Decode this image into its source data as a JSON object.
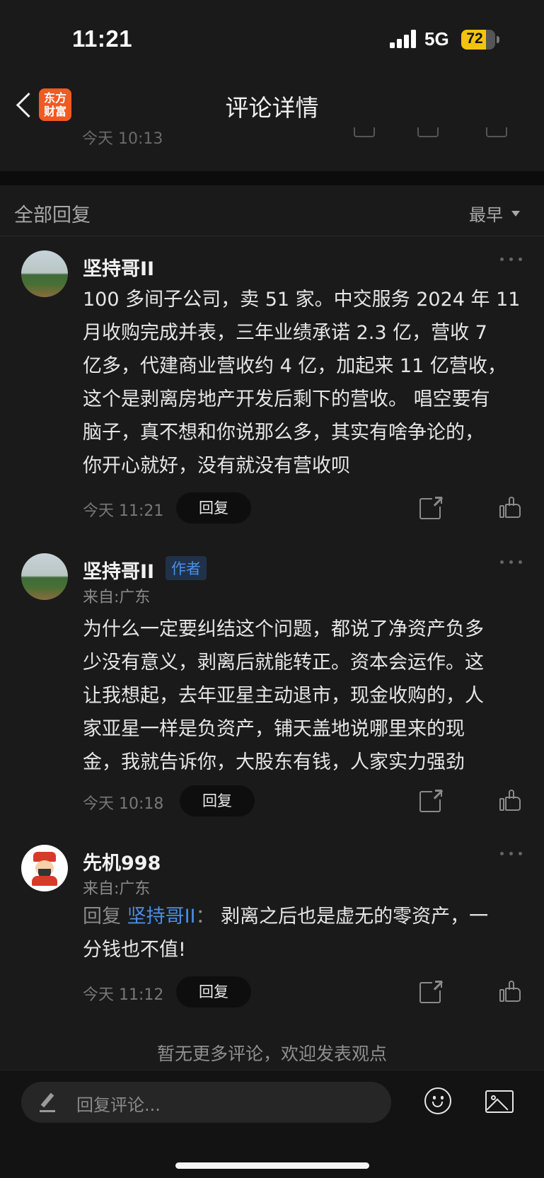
{
  "status_bar": {
    "time": "11:21",
    "network": "5G",
    "battery": "72",
    "battery_level": 0.72
  },
  "header": {
    "logo_line1": "东方",
    "logo_line2": "财富",
    "title": "评论详情"
  },
  "previous_comment": {
    "time": "今天 10:13"
  },
  "section": {
    "title": "全部回复",
    "sort_label": "最早"
  },
  "comments": [
    {
      "user": "坚持哥II",
      "avatar_icon": "landscape-avatar",
      "lines": [
        "100 多间子公司，卖 51 家。中交服务 2024 年 11",
        "月收购完成并表，三年业绩承诺 2.3 亿，营收 7",
        "亿多，代建商业营收约 4 亿，加起来 11 亿营收，",
        "这个是剥离房地产开发后剩下的营收。 唱空要有",
        "脑子，真不想和你说那么多，其实有啥争论的，",
        "你开心就好，没有就没有营收呗"
      ],
      "time": "今天 11:21",
      "reply_label": "回复"
    },
    {
      "user": "坚持哥II",
      "badge": "作者",
      "from": "来自:广东",
      "avatar_icon": "landscape-avatar",
      "lines": [
        "为什么一定要纠结这个问题，都说了净资产负多",
        "少没有意义，剥离后就能转正。资本会运作。这",
        "让我想起，去年亚星主动退市，现金收购的，人",
        "家亚星一样是负资产，铺天盖地说哪里来的现",
        "金，我就告诉你，大股东有钱，人家实力强劲"
      ],
      "time": "今天 10:18",
      "reply_label": "回复"
    },
    {
      "user": "先机998",
      "from": "来自:广东",
      "avatar_icon": "fortune-god-avatar",
      "reply_prefix": "回复",
      "reply_to": "坚持哥II",
      "reply_sep": "：",
      "line1": "剥离之后也是虚无的零资产，一",
      "line2": "分钱也不值!",
      "time": "今天 11:12",
      "reply_label": "回复"
    }
  ],
  "end_note": "暂无更多评论，欢迎发表观点",
  "bottom_bar": {
    "input_placeholder": "回复评论..."
  },
  "colors": {
    "background": "#1a1a1a",
    "accent_blue": "#4a8fe7",
    "brand_orange": "#f15a22",
    "battery_yellow": "#f2c40f"
  }
}
